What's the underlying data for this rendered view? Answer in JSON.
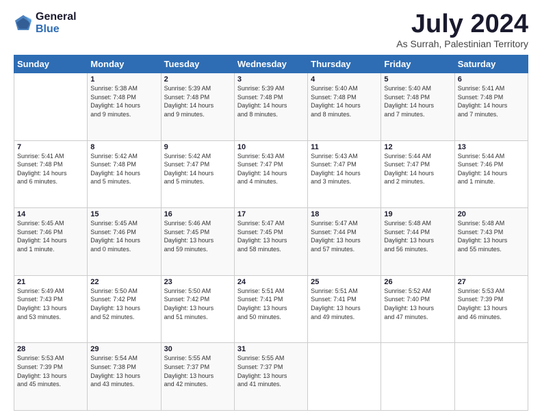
{
  "header": {
    "logo_general": "General",
    "logo_blue": "Blue",
    "month": "July 2024",
    "location": "As Surrah, Palestinian Territory"
  },
  "weekdays": [
    "Sunday",
    "Monday",
    "Tuesday",
    "Wednesday",
    "Thursday",
    "Friday",
    "Saturday"
  ],
  "weeks": [
    [
      {
        "day": "",
        "info": ""
      },
      {
        "day": "1",
        "info": "Sunrise: 5:38 AM\nSunset: 7:48 PM\nDaylight: 14 hours\nand 9 minutes."
      },
      {
        "day": "2",
        "info": "Sunrise: 5:39 AM\nSunset: 7:48 PM\nDaylight: 14 hours\nand 9 minutes."
      },
      {
        "day": "3",
        "info": "Sunrise: 5:39 AM\nSunset: 7:48 PM\nDaylight: 14 hours\nand 8 minutes."
      },
      {
        "day": "4",
        "info": "Sunrise: 5:40 AM\nSunset: 7:48 PM\nDaylight: 14 hours\nand 8 minutes."
      },
      {
        "day": "5",
        "info": "Sunrise: 5:40 AM\nSunset: 7:48 PM\nDaylight: 14 hours\nand 7 minutes."
      },
      {
        "day": "6",
        "info": "Sunrise: 5:41 AM\nSunset: 7:48 PM\nDaylight: 14 hours\nand 7 minutes."
      }
    ],
    [
      {
        "day": "7",
        "info": "Sunrise: 5:41 AM\nSunset: 7:48 PM\nDaylight: 14 hours\nand 6 minutes."
      },
      {
        "day": "8",
        "info": "Sunrise: 5:42 AM\nSunset: 7:48 PM\nDaylight: 14 hours\nand 5 minutes."
      },
      {
        "day": "9",
        "info": "Sunrise: 5:42 AM\nSunset: 7:47 PM\nDaylight: 14 hours\nand 5 minutes."
      },
      {
        "day": "10",
        "info": "Sunrise: 5:43 AM\nSunset: 7:47 PM\nDaylight: 14 hours\nand 4 minutes."
      },
      {
        "day": "11",
        "info": "Sunrise: 5:43 AM\nSunset: 7:47 PM\nDaylight: 14 hours\nand 3 minutes."
      },
      {
        "day": "12",
        "info": "Sunrise: 5:44 AM\nSunset: 7:47 PM\nDaylight: 14 hours\nand 2 minutes."
      },
      {
        "day": "13",
        "info": "Sunrise: 5:44 AM\nSunset: 7:46 PM\nDaylight: 14 hours\nand 1 minute."
      }
    ],
    [
      {
        "day": "14",
        "info": "Sunrise: 5:45 AM\nSunset: 7:46 PM\nDaylight: 14 hours\nand 1 minute."
      },
      {
        "day": "15",
        "info": "Sunrise: 5:45 AM\nSunset: 7:46 PM\nDaylight: 14 hours\nand 0 minutes."
      },
      {
        "day": "16",
        "info": "Sunrise: 5:46 AM\nSunset: 7:45 PM\nDaylight: 13 hours\nand 59 minutes."
      },
      {
        "day": "17",
        "info": "Sunrise: 5:47 AM\nSunset: 7:45 PM\nDaylight: 13 hours\nand 58 minutes."
      },
      {
        "day": "18",
        "info": "Sunrise: 5:47 AM\nSunset: 7:44 PM\nDaylight: 13 hours\nand 57 minutes."
      },
      {
        "day": "19",
        "info": "Sunrise: 5:48 AM\nSunset: 7:44 PM\nDaylight: 13 hours\nand 56 minutes."
      },
      {
        "day": "20",
        "info": "Sunrise: 5:48 AM\nSunset: 7:43 PM\nDaylight: 13 hours\nand 55 minutes."
      }
    ],
    [
      {
        "day": "21",
        "info": "Sunrise: 5:49 AM\nSunset: 7:43 PM\nDaylight: 13 hours\nand 53 minutes."
      },
      {
        "day": "22",
        "info": "Sunrise: 5:50 AM\nSunset: 7:42 PM\nDaylight: 13 hours\nand 52 minutes."
      },
      {
        "day": "23",
        "info": "Sunrise: 5:50 AM\nSunset: 7:42 PM\nDaylight: 13 hours\nand 51 minutes."
      },
      {
        "day": "24",
        "info": "Sunrise: 5:51 AM\nSunset: 7:41 PM\nDaylight: 13 hours\nand 50 minutes."
      },
      {
        "day": "25",
        "info": "Sunrise: 5:51 AM\nSunset: 7:41 PM\nDaylight: 13 hours\nand 49 minutes."
      },
      {
        "day": "26",
        "info": "Sunrise: 5:52 AM\nSunset: 7:40 PM\nDaylight: 13 hours\nand 47 minutes."
      },
      {
        "day": "27",
        "info": "Sunrise: 5:53 AM\nSunset: 7:39 PM\nDaylight: 13 hours\nand 46 minutes."
      }
    ],
    [
      {
        "day": "28",
        "info": "Sunrise: 5:53 AM\nSunset: 7:39 PM\nDaylight: 13 hours\nand 45 minutes."
      },
      {
        "day": "29",
        "info": "Sunrise: 5:54 AM\nSunset: 7:38 PM\nDaylight: 13 hours\nand 43 minutes."
      },
      {
        "day": "30",
        "info": "Sunrise: 5:55 AM\nSunset: 7:37 PM\nDaylight: 13 hours\nand 42 minutes."
      },
      {
        "day": "31",
        "info": "Sunrise: 5:55 AM\nSunset: 7:37 PM\nDaylight: 13 hours\nand 41 minutes."
      },
      {
        "day": "",
        "info": ""
      },
      {
        "day": "",
        "info": ""
      },
      {
        "day": "",
        "info": ""
      }
    ]
  ]
}
